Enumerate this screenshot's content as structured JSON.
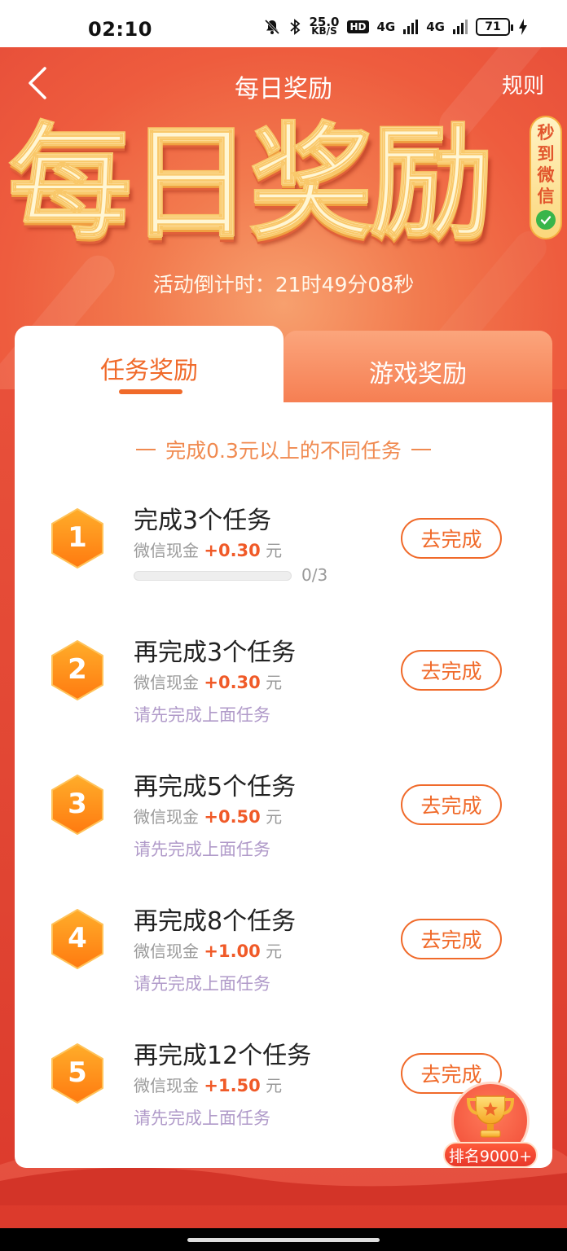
{
  "status_bar": {
    "time": "02:10",
    "net_speed": "25.0",
    "net_unit": "KB/S",
    "hd": "HD",
    "signal_1": "4G",
    "signal_2": "4G",
    "battery": "71"
  },
  "nav": {
    "back_icon": "chevron-left-icon",
    "title": "每日奖励",
    "rules": "规则"
  },
  "hero": {
    "big_title": "每日奖励",
    "side_badge": [
      "秒",
      "到",
      "微",
      "信"
    ],
    "countdown_label": "活动倒计时：",
    "countdown_value": "21时49分08秒"
  },
  "tabs": {
    "active": "任务奖励",
    "inactive": "游戏奖励"
  },
  "section_title": "完成0.3元以上的不同任务",
  "tasks": [
    {
      "num": "1",
      "title": "完成3个任务",
      "reward_prefix": "微信现金 ",
      "amount": "+0.30",
      "unit": " 元",
      "progress_text": "0/3",
      "progress": 0,
      "button": "去完成"
    },
    {
      "num": "2",
      "title": "再完成3个任务",
      "reward_prefix": "微信现金 ",
      "amount": "+0.30",
      "unit": " 元",
      "hint": "请先完成上面任务",
      "button": "去完成"
    },
    {
      "num": "3",
      "title": "再完成5个任务",
      "reward_prefix": "微信现金 ",
      "amount": "+0.50",
      "unit": " 元",
      "hint": "请先完成上面任务",
      "button": "去完成"
    },
    {
      "num": "4",
      "title": "再完成8个任务",
      "reward_prefix": "微信现金 ",
      "amount": "+1.00",
      "unit": " 元",
      "hint": "请先完成上面任务",
      "button": "去完成"
    },
    {
      "num": "5",
      "title": "再完成12个任务",
      "reward_prefix": "微信现金 ",
      "amount": "+1.50",
      "unit": " 元",
      "hint": "请先完成上面任务",
      "button": "去完成"
    }
  ],
  "ranking": {
    "icon": "trophy-icon",
    "label": "排名9000+"
  },
  "colors": {
    "accent": "#f06a2a",
    "hero_bg": "#ee5c3e",
    "background": "#d8342a",
    "hint": "#b09ac9"
  }
}
